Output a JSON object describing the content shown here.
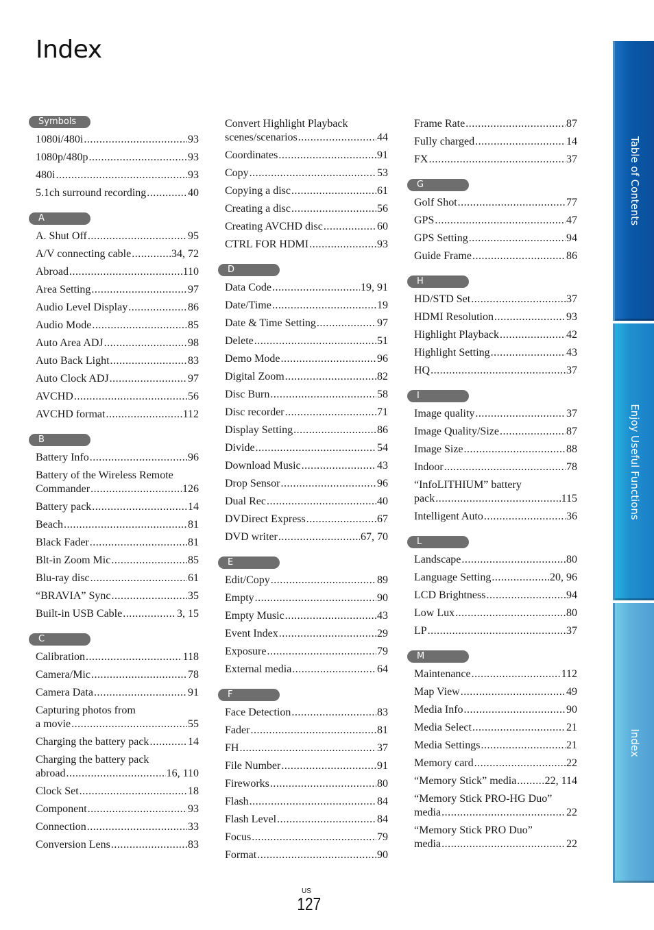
{
  "title": "Index",
  "page": {
    "region": "US",
    "number": "127"
  },
  "sidetabs": [
    "Table of Contents",
    "Enjoy Useful Functions",
    "Index"
  ],
  "colors": {
    "letter_badge": "#6e6e6e",
    "tab_toc": "#0a58a8",
    "tab_functions": "#1f8fcf",
    "tab_index": "#5fb0dc"
  },
  "columns": [
    {
      "sections": [
        {
          "letter": "Symbols",
          "entries": [
            {
              "label": "1080i/480i",
              "page": "93"
            },
            {
              "label": "1080p/480p",
              "page": "93"
            },
            {
              "label": "480i",
              "page": "93"
            },
            {
              "label": "5.1ch surround recording",
              "page": "40"
            }
          ]
        },
        {
          "letter": "A",
          "entries": [
            {
              "label": "A. Shut Off",
              "page": "95"
            },
            {
              "label": "A/V connecting cable",
              "page": "34, 72"
            },
            {
              "label": "Abroad",
              "page": "110"
            },
            {
              "label": "Area Setting",
              "page": "97"
            },
            {
              "label": "Audio Level Display",
              "page": "86"
            },
            {
              "label": "Audio Mode",
              "page": "85"
            },
            {
              "label": "Auto Area ADJ",
              "page": "98"
            },
            {
              "label": "Auto Back Light",
              "page": "83"
            },
            {
              "label": "Auto Clock ADJ",
              "page": "97"
            },
            {
              "label": "AVCHD",
              "page": "56"
            },
            {
              "label": "AVCHD format",
              "page": "112"
            }
          ]
        },
        {
          "letter": "B",
          "entries": [
            {
              "label": "Battery Info",
              "page": "96"
            },
            {
              "line1": "Battery of the Wireless Remote",
              "label": "Commander",
              "page": "126"
            },
            {
              "label": "Battery pack",
              "page": "14"
            },
            {
              "label": "Beach",
              "page": "81"
            },
            {
              "label": "Black Fader",
              "page": "81"
            },
            {
              "label": "Blt-in Zoom Mic",
              "page": "85"
            },
            {
              "label": "Blu-ray disc",
              "page": "61"
            },
            {
              "label": "“BRAVIA” Sync",
              "page": "35"
            },
            {
              "label": "Built-in USB Cable",
              "page": "3, 15"
            }
          ]
        },
        {
          "letter": "C",
          "entries": [
            {
              "label": "Calibration",
              "page": "118"
            },
            {
              "label": "Camera/Mic",
              "page": "78"
            },
            {
              "label": "Camera Data",
              "page": "91"
            },
            {
              "line1": "Capturing photos from",
              "label": "a movie",
              "page": "55"
            },
            {
              "label": "Charging the battery pack",
              "page": "14"
            },
            {
              "line1": "Charging the battery pack",
              "label": "abroad",
              "page": "16, 110"
            },
            {
              "label": "Clock Set",
              "page": "18"
            },
            {
              "label": "Component",
              "page": "93"
            },
            {
              "label": "Connection",
              "page": "33"
            },
            {
              "label": "Conversion Lens",
              "page": "83"
            }
          ]
        }
      ]
    },
    {
      "sections": [
        {
          "letter": "",
          "entries": [
            {
              "line1": "Convert Highlight Playback",
              "label": "scenes/scenarios",
              "page": "44"
            },
            {
              "label": "Coordinates",
              "page": "91"
            },
            {
              "label": "Copy",
              "page": "53"
            },
            {
              "label": "Copying a disc",
              "page": "61"
            },
            {
              "label": "Creating a disc",
              "page": "56"
            },
            {
              "label": "Creating AVCHD disc",
              "page": "60"
            },
            {
              "label": "CTRL FOR HDMI",
              "page": "93"
            }
          ]
        },
        {
          "letter": "D",
          "entries": [
            {
              "label": "Data Code",
              "page": "19, 91"
            },
            {
              "label": "Date/Time",
              "page": "19"
            },
            {
              "label": "Date & Time Setting",
              "page": "97"
            },
            {
              "label": "Delete",
              "page": "51"
            },
            {
              "label": "Demo Mode",
              "page": "96"
            },
            {
              "label": "Digital Zoom",
              "page": "82"
            },
            {
              "label": "Disc Burn",
              "page": "58"
            },
            {
              "label": "Disc recorder",
              "page": "71"
            },
            {
              "label": "Display Setting",
              "page": "86"
            },
            {
              "label": "Divide",
              "page": "54"
            },
            {
              "label": "Download Music",
              "page": "43"
            },
            {
              "label": "Drop Sensor",
              "page": "96"
            },
            {
              "label": "Dual Rec",
              "page": "40"
            },
            {
              "label": "DVDirect Express",
              "page": "67"
            },
            {
              "label": "DVD writer",
              "page": "67, 70"
            }
          ]
        },
        {
          "letter": "E",
          "entries": [
            {
              "label": "Edit/Copy",
              "page": "89"
            },
            {
              "label": "Empty",
              "page": "90"
            },
            {
              "label": "Empty Music",
              "page": "43"
            },
            {
              "label": "Event Index",
              "page": "29"
            },
            {
              "label": "Exposure",
              "page": "79"
            },
            {
              "label": "External media",
              "page": "64"
            }
          ]
        },
        {
          "letter": "F",
          "entries": [
            {
              "label": "Face Detection",
              "page": "83"
            },
            {
              "label": "Fader",
              "page": "81"
            },
            {
              "label": "FH",
              "page": "37"
            },
            {
              "label": "File Number",
              "page": "91"
            },
            {
              "label": "Fireworks",
              "page": "80"
            },
            {
              "label": "Flash",
              "page": "84"
            },
            {
              "label": "Flash Level",
              "page": "84"
            },
            {
              "label": "Focus",
              "page": "79"
            },
            {
              "label": "Format",
              "page": "90"
            }
          ]
        }
      ]
    },
    {
      "sections": [
        {
          "letter": "",
          "entries": [
            {
              "label": "Frame Rate",
              "page": "87"
            },
            {
              "label": "Fully charged",
              "page": "14"
            },
            {
              "label": "FX",
              "page": "37"
            }
          ]
        },
        {
          "letter": "G",
          "entries": [
            {
              "label": "Golf Shot",
              "page": "77"
            },
            {
              "label": "GPS",
              "page": "47"
            },
            {
              "label": "GPS Setting",
              "page": "94"
            },
            {
              "label": "Guide Frame",
              "page": "86"
            }
          ]
        },
        {
          "letter": "H",
          "entries": [
            {
              "label": "HD/STD Set",
              "page": "37"
            },
            {
              "label": "HDMI Resolution",
              "page": "93"
            },
            {
              "label": "Highlight Playback",
              "page": "42"
            },
            {
              "label": "Highlight Setting",
              "page": "43"
            },
            {
              "label": "HQ",
              "page": "37"
            }
          ]
        },
        {
          "letter": "I",
          "entries": [
            {
              "label": "Image quality",
              "page": "37"
            },
            {
              "label": "Image Quality/Size",
              "page": "87"
            },
            {
              "label": "Image Size",
              "page": "88"
            },
            {
              "label": "Indoor",
              "page": "78"
            },
            {
              "line1": "“InfoLITHIUM” battery",
              "label": "pack",
              "page": "115"
            },
            {
              "label": "Intelligent Auto",
              "page": "36"
            }
          ]
        },
        {
          "letter": "L",
          "entries": [
            {
              "label": "Landscape",
              "page": "80"
            },
            {
              "label": "Language Setting",
              "page": "20, 96"
            },
            {
              "label": "LCD Brightness",
              "page": "94"
            },
            {
              "label": "Low Lux",
              "page": "80"
            },
            {
              "label": "LP",
              "page": "37"
            }
          ]
        },
        {
          "letter": "M",
          "entries": [
            {
              "label": "Maintenance",
              "page": "112"
            },
            {
              "label": "Map View",
              "page": "49"
            },
            {
              "label": "Media Info",
              "page": "90"
            },
            {
              "label": "Media Select",
              "page": "21"
            },
            {
              "label": "Media Settings",
              "page": "21"
            },
            {
              "label": "Memory card",
              "page": "22"
            },
            {
              "label": "“Memory Stick” media",
              "page": "22, 114"
            },
            {
              "line1": "“Memory Stick PRO-HG Duo”",
              "label": "media",
              "page": "22"
            },
            {
              "line1": "“Memory Stick PRO Duo”",
              "label": "media",
              "page": "22"
            }
          ]
        }
      ]
    }
  ]
}
